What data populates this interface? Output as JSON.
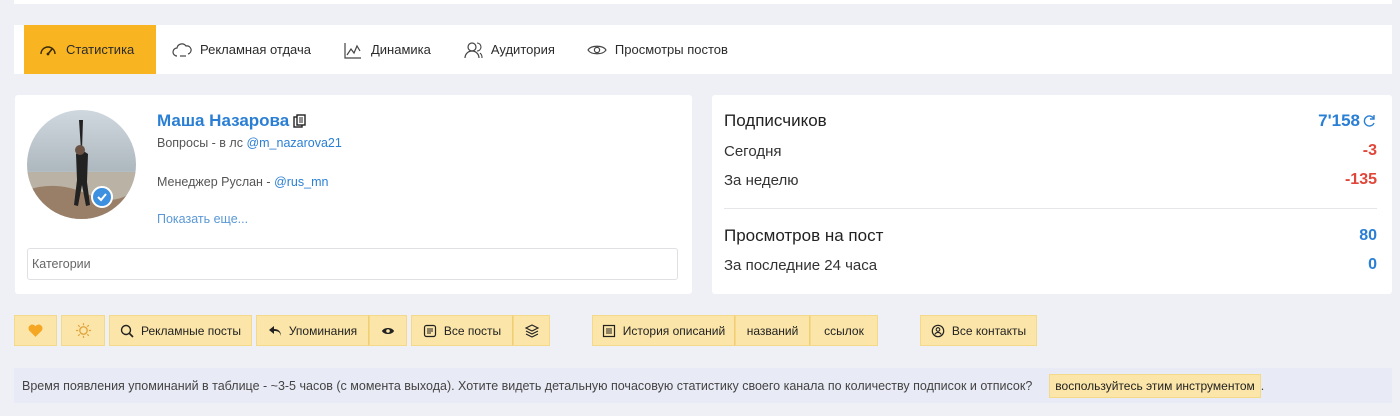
{
  "tabs": [
    {
      "label": "Статистика",
      "icon": "gauge-icon",
      "active": true
    },
    {
      "label": "Рекламная отдача",
      "icon": "cloud-icon"
    },
    {
      "label": "Динамика",
      "icon": "chart-icon"
    },
    {
      "label": "Аудитория",
      "icon": "users-icon"
    },
    {
      "label": "Просмотры постов",
      "icon": "eye-icon"
    }
  ],
  "profile": {
    "name": "Маша Назарова",
    "line1_prefix": "Вопросы - в лс ",
    "line1_link": "@m_nazarova21",
    "line2_prefix": "Менеджер Руслан - ",
    "line2_link": "@rus_mn",
    "show_more": "Показать еще...",
    "categories_placeholder": "Категории"
  },
  "stats": {
    "subscribers_label": "Подписчиков",
    "subscribers_value": "7'158",
    "today_label": "Сегодня",
    "today_value": "-3",
    "week_label": "За неделю",
    "week_value": "-135",
    "views_label": "Просмотров на пост",
    "views_value": "80",
    "views24_label": "За последние 24 часа",
    "views24_value": "0"
  },
  "actions": {
    "ads_posts": "Рекламные посты",
    "mentions": "Упоминания",
    "all_posts": "Все посты",
    "desc_history": "История описаний",
    "names": "названий",
    "links": "ссылок",
    "all_contacts": "Все контакты"
  },
  "notice": {
    "text": "Время появления упоминаний в таблице - ~3-5 часов (с момента выхода). Хотите видеть детальную почасовую статистику своего канала по количеству подписок и отписок?",
    "tool_label": "воспользуйтесь этим инструментом",
    "tail": "."
  },
  "colors": {
    "accent": "#f8b521",
    "link": "#2a7fd4",
    "negative": "#e0473a",
    "button_bg": "#fbe5a8"
  }
}
